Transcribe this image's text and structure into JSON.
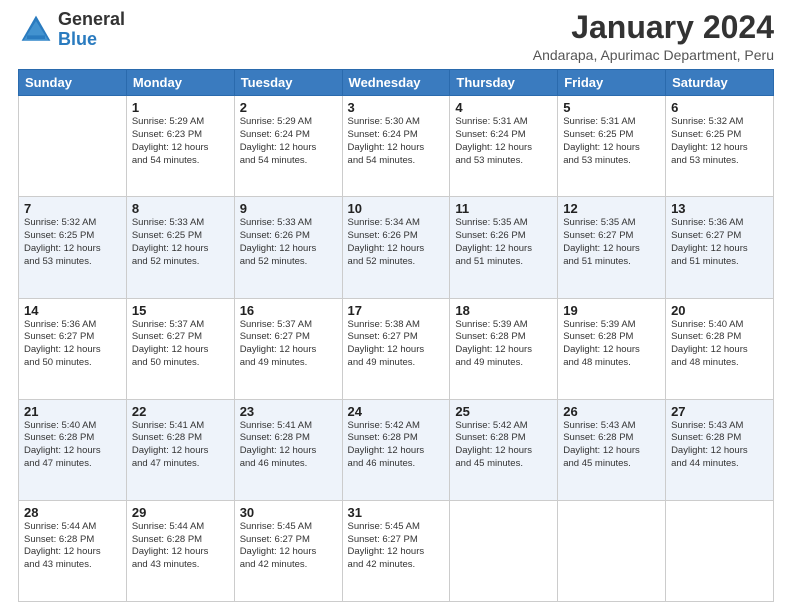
{
  "logo": {
    "general": "General",
    "blue": "Blue"
  },
  "header": {
    "month": "January 2024",
    "location": "Andarapa, Apurimac Department, Peru"
  },
  "days_of_week": [
    "Sunday",
    "Monday",
    "Tuesday",
    "Wednesday",
    "Thursday",
    "Friday",
    "Saturday"
  ],
  "weeks": [
    [
      {
        "day": "",
        "info": ""
      },
      {
        "day": "1",
        "info": "Sunrise: 5:29 AM\nSunset: 6:23 PM\nDaylight: 12 hours\nand 54 minutes."
      },
      {
        "day": "2",
        "info": "Sunrise: 5:29 AM\nSunset: 6:24 PM\nDaylight: 12 hours\nand 54 minutes."
      },
      {
        "day": "3",
        "info": "Sunrise: 5:30 AM\nSunset: 6:24 PM\nDaylight: 12 hours\nand 54 minutes."
      },
      {
        "day": "4",
        "info": "Sunrise: 5:31 AM\nSunset: 6:24 PM\nDaylight: 12 hours\nand 53 minutes."
      },
      {
        "day": "5",
        "info": "Sunrise: 5:31 AM\nSunset: 6:25 PM\nDaylight: 12 hours\nand 53 minutes."
      },
      {
        "day": "6",
        "info": "Sunrise: 5:32 AM\nSunset: 6:25 PM\nDaylight: 12 hours\nand 53 minutes."
      }
    ],
    [
      {
        "day": "7",
        "info": "Sunrise: 5:32 AM\nSunset: 6:25 PM\nDaylight: 12 hours\nand 53 minutes."
      },
      {
        "day": "8",
        "info": "Sunrise: 5:33 AM\nSunset: 6:25 PM\nDaylight: 12 hours\nand 52 minutes."
      },
      {
        "day": "9",
        "info": "Sunrise: 5:33 AM\nSunset: 6:26 PM\nDaylight: 12 hours\nand 52 minutes."
      },
      {
        "day": "10",
        "info": "Sunrise: 5:34 AM\nSunset: 6:26 PM\nDaylight: 12 hours\nand 52 minutes."
      },
      {
        "day": "11",
        "info": "Sunrise: 5:35 AM\nSunset: 6:26 PM\nDaylight: 12 hours\nand 51 minutes."
      },
      {
        "day": "12",
        "info": "Sunrise: 5:35 AM\nSunset: 6:27 PM\nDaylight: 12 hours\nand 51 minutes."
      },
      {
        "day": "13",
        "info": "Sunrise: 5:36 AM\nSunset: 6:27 PM\nDaylight: 12 hours\nand 51 minutes."
      }
    ],
    [
      {
        "day": "14",
        "info": "Sunrise: 5:36 AM\nSunset: 6:27 PM\nDaylight: 12 hours\nand 50 minutes."
      },
      {
        "day": "15",
        "info": "Sunrise: 5:37 AM\nSunset: 6:27 PM\nDaylight: 12 hours\nand 50 minutes."
      },
      {
        "day": "16",
        "info": "Sunrise: 5:37 AM\nSunset: 6:27 PM\nDaylight: 12 hours\nand 49 minutes."
      },
      {
        "day": "17",
        "info": "Sunrise: 5:38 AM\nSunset: 6:27 PM\nDaylight: 12 hours\nand 49 minutes."
      },
      {
        "day": "18",
        "info": "Sunrise: 5:39 AM\nSunset: 6:28 PM\nDaylight: 12 hours\nand 49 minutes."
      },
      {
        "day": "19",
        "info": "Sunrise: 5:39 AM\nSunset: 6:28 PM\nDaylight: 12 hours\nand 48 minutes."
      },
      {
        "day": "20",
        "info": "Sunrise: 5:40 AM\nSunset: 6:28 PM\nDaylight: 12 hours\nand 48 minutes."
      }
    ],
    [
      {
        "day": "21",
        "info": "Sunrise: 5:40 AM\nSunset: 6:28 PM\nDaylight: 12 hours\nand 47 minutes."
      },
      {
        "day": "22",
        "info": "Sunrise: 5:41 AM\nSunset: 6:28 PM\nDaylight: 12 hours\nand 47 minutes."
      },
      {
        "day": "23",
        "info": "Sunrise: 5:41 AM\nSunset: 6:28 PM\nDaylight: 12 hours\nand 46 minutes."
      },
      {
        "day": "24",
        "info": "Sunrise: 5:42 AM\nSunset: 6:28 PM\nDaylight: 12 hours\nand 46 minutes."
      },
      {
        "day": "25",
        "info": "Sunrise: 5:42 AM\nSunset: 6:28 PM\nDaylight: 12 hours\nand 45 minutes."
      },
      {
        "day": "26",
        "info": "Sunrise: 5:43 AM\nSunset: 6:28 PM\nDaylight: 12 hours\nand 45 minutes."
      },
      {
        "day": "27",
        "info": "Sunrise: 5:43 AM\nSunset: 6:28 PM\nDaylight: 12 hours\nand 44 minutes."
      }
    ],
    [
      {
        "day": "28",
        "info": "Sunrise: 5:44 AM\nSunset: 6:28 PM\nDaylight: 12 hours\nand 43 minutes."
      },
      {
        "day": "29",
        "info": "Sunrise: 5:44 AM\nSunset: 6:28 PM\nDaylight: 12 hours\nand 43 minutes."
      },
      {
        "day": "30",
        "info": "Sunrise: 5:45 AM\nSunset: 6:27 PM\nDaylight: 12 hours\nand 42 minutes."
      },
      {
        "day": "31",
        "info": "Sunrise: 5:45 AM\nSunset: 6:27 PM\nDaylight: 12 hours\nand 42 minutes."
      },
      {
        "day": "",
        "info": ""
      },
      {
        "day": "",
        "info": ""
      },
      {
        "day": "",
        "info": ""
      }
    ]
  ]
}
